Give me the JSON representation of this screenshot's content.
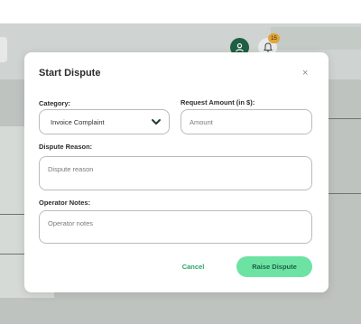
{
  "background": {
    "notification_count": "15"
  },
  "modal": {
    "title": "Start Dispute",
    "close_symbol": "×",
    "category": {
      "label": "Category:",
      "selected": "Invoice Complaint"
    },
    "amount": {
      "label": "Request Amount (in $):",
      "placeholder": "Amount"
    },
    "reason": {
      "label": "Dispute Reason:",
      "placeholder": "Dispute reason"
    },
    "notes": {
      "label": "Operator Notes:",
      "placeholder": "Operator notes"
    },
    "cancel_label": "Cancel",
    "submit_label": "Raise Dispute"
  },
  "colors": {
    "accent": "#6ce3a3",
    "accent_text": "#1f5f43",
    "cancel_text": "#2ea56b",
    "overlay": "#bfc3c0"
  }
}
